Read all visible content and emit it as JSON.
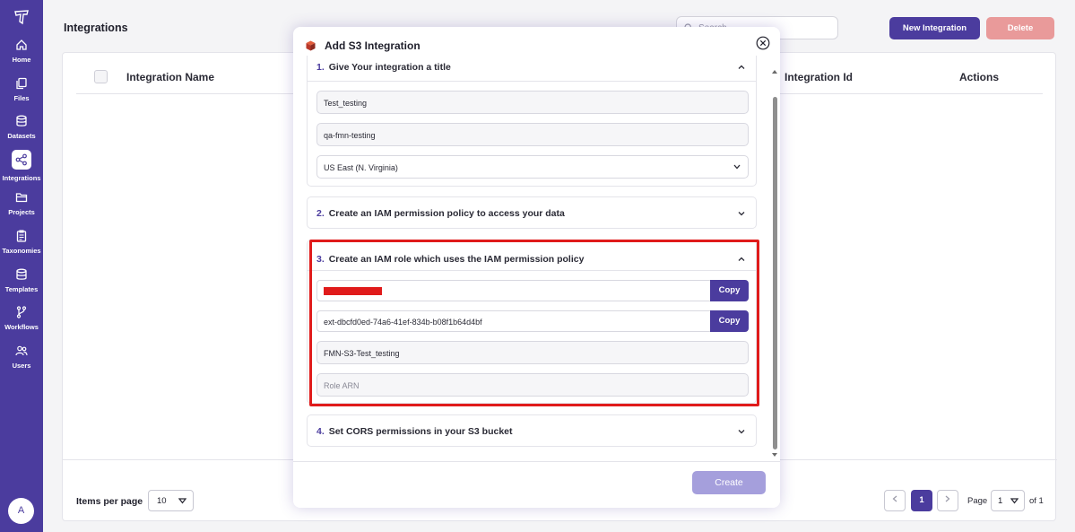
{
  "sidebar": {
    "items": [
      {
        "label": "Home"
      },
      {
        "label": "Files"
      },
      {
        "label": "Datasets"
      },
      {
        "label": "Integrations"
      },
      {
        "label": "Projects"
      },
      {
        "label": "Taxonomies"
      },
      {
        "label": "Templates"
      },
      {
        "label": "Workflows"
      },
      {
        "label": "Users"
      }
    ],
    "active": "Integrations",
    "avatar_initial": "A"
  },
  "header": {
    "title": "Integrations",
    "search_placeholder": "Search",
    "new_button": "New Integration",
    "delete_button": "Delete"
  },
  "table": {
    "columns": [
      "Integration Name",
      "Integration Id",
      "Actions"
    ]
  },
  "footer": {
    "items_per_page_label": "Items per page",
    "items_per_page_value": "10",
    "current_page": "1",
    "page_label": "Page",
    "page_select_value": "1",
    "of_label": "of 1"
  },
  "modal": {
    "title": "Add S3 Integration",
    "sections": [
      {
        "number": "1.",
        "title": "Give Your integration a title",
        "fields": {
          "name": "Test_testing",
          "bucket": "qa-fmn-testing",
          "region": "US East (N. Virginia)"
        }
      },
      {
        "number": "2.",
        "title": "Create an IAM permission policy to access your data"
      },
      {
        "number": "3.",
        "title": "Create an IAM role which uses the IAM permission policy",
        "fields": {
          "external_id": "ext-dbcfd0ed-74a6-41ef-834b-b08f1b64d4bf",
          "role_name": "FMN-S3-Test_testing",
          "role_arn_placeholder": "Role ARN"
        },
        "copy_label": "Copy"
      },
      {
        "number": "4.",
        "title": "Set CORS permissions in your S3 bucket"
      }
    ],
    "create_button": "Create"
  },
  "colors": {
    "brand": "#4b3c9e",
    "delete": "#e99a9a",
    "highlight": "#e01b1b",
    "create_disabled": "#a59fdc"
  },
  "icons": [
    "logo-icon",
    "home-icon",
    "files-icon",
    "datasets-icon",
    "integrations-icon",
    "projects-icon",
    "taxonomies-icon",
    "templates-icon",
    "workflows-icon",
    "users-icon",
    "search-icon",
    "close-icon",
    "chevron-up-icon",
    "chevron-down-icon",
    "aws-cube-icon"
  ]
}
